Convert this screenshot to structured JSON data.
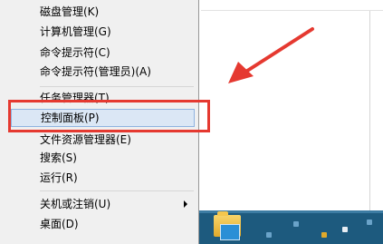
{
  "menu": {
    "items": [
      {
        "label": "磁盘管理(K)"
      },
      {
        "label": "计算机管理(G)"
      },
      {
        "label": "命令提示符(C)"
      },
      {
        "label": "命令提示符(管理员)(A)"
      },
      {
        "label": "任务管理器(T)"
      },
      {
        "label": "控制面板(P)",
        "selected": true
      },
      {
        "label": "文件资源管理器(E)"
      },
      {
        "label": "搜索(S)"
      },
      {
        "label": "运行(R)"
      },
      {
        "label": "关机或注销(U)",
        "has_submenu": true
      },
      {
        "label": "桌面(D)"
      }
    ]
  },
  "annotation": {
    "arrow_color": "#e53930",
    "box_color": "#e53930"
  },
  "taskbar": {
    "color": "#1d5a7e",
    "icons": [
      "folder-icon",
      "file-explorer-icon"
    ]
  }
}
